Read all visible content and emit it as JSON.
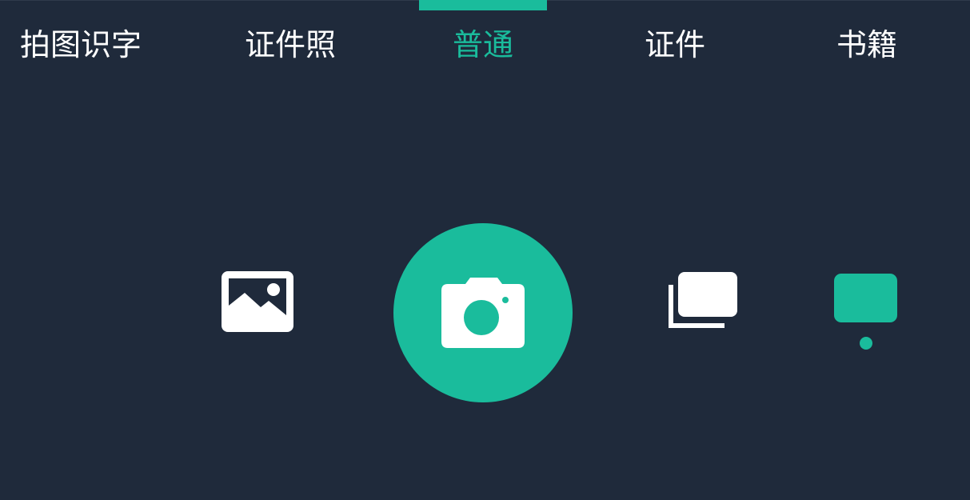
{
  "tabs": [
    {
      "label": "拍图识字",
      "active": false
    },
    {
      "label": "证件照",
      "active": false
    },
    {
      "label": "普通",
      "active": true
    },
    {
      "label": "证件",
      "active": false
    },
    {
      "label": "书籍",
      "active": false
    }
  ],
  "colors": {
    "background": "#1f2a3b",
    "accent": "#1abc9c",
    "text": "#ffffff"
  },
  "controls": {
    "gallery_icon": "image-icon",
    "shutter_icon": "camera-icon",
    "batch_icon": "stacked-photos-icon",
    "thumbnail_indicator": "dot"
  }
}
